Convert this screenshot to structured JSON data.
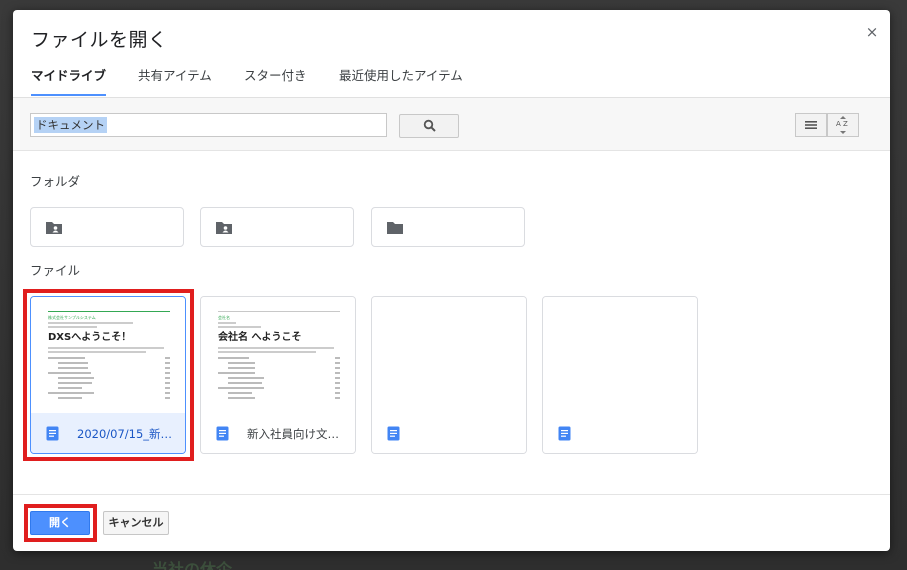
{
  "dialog": {
    "title": "ファイルを開く",
    "close_symbol": "×"
  },
  "tabs": [
    {
      "label": "マイドライブ",
      "active": true
    },
    {
      "label": "共有アイテム",
      "active": false
    },
    {
      "label": "スター付き",
      "active": false
    },
    {
      "label": "最近使用したアイテム",
      "active": false
    }
  ],
  "search": {
    "value": "ドキュメント",
    "button_icon": "search-icon"
  },
  "view_controls": {
    "list_icon": "list-view-icon",
    "sort_icon": "sort-az-icon",
    "sort_label": "A Z"
  },
  "folders_section": {
    "label": "フォルダ",
    "folders": [
      {
        "icon": "shared-folder-icon"
      },
      {
        "icon": "shared-folder-icon"
      },
      {
        "icon": "folder-icon"
      }
    ]
  },
  "files_section": {
    "label": "ファイル",
    "files": [
      {
        "name": "2020/07/15_新入…",
        "selected": true,
        "icon": "docs-icon",
        "preview": {
          "brand": "株式会社サンプルシステム",
          "heading": "DXSへようこそ！"
        }
      },
      {
        "name": "新入社員向け文書…",
        "selected": false,
        "icon": "docs-icon",
        "preview": {
          "brand": "会社名",
          "heading": "会社名 へようこそ"
        }
      },
      {
        "name": "",
        "selected": false,
        "icon": "docs-icon",
        "preview": null
      },
      {
        "name": "",
        "selected": false,
        "icon": "docs-icon",
        "preview": null
      }
    ]
  },
  "actions": {
    "open_label": "開く",
    "cancel_label": "キャンセル"
  },
  "background": {
    "partial_text": "当社の休企"
  },
  "colors": {
    "accent": "#4d90fe",
    "highlight": "#e01e1e",
    "docs_blue": "#4285f4"
  }
}
